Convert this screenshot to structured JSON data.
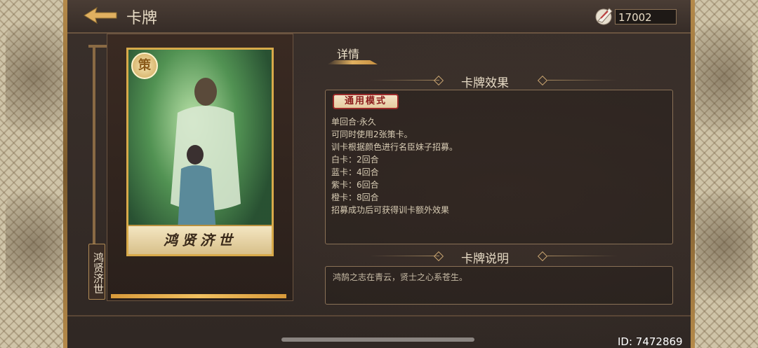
{
  "header": {
    "title": "卡牌",
    "currency_value": "17002"
  },
  "card": {
    "badge": "策",
    "name": "鸿贤济世",
    "vertical_label": "鸿贤济世"
  },
  "tabs": [
    {
      "label": "详情"
    }
  ],
  "sections": {
    "effect_title": "卡牌效果",
    "mode_badge": "通用模式",
    "effect_lines": [
      "单回合·永久",
      "可同时使用2张策卡。",
      "训卡根据颜色进行名臣妹子招募。",
      "白卡：2回合",
      "蓝卡：4回合",
      "紫卡：6回合",
      "橙卡：8回合",
      "招募成功后可获得训卡额外效果"
    ],
    "desc_title": "卡牌说明",
    "desc_text": "鸿鹄之志在青云，贤士之心系苍生。"
  },
  "footer": {
    "id_text": "ID: 7472869"
  },
  "icons": {
    "back": "back-arrow-icon",
    "currency": "feather-currency-icon"
  },
  "colors": {
    "accent_gold": "#d8aa4a",
    "mode_red": "#9a2a2a",
    "text_light": "#e8dcc6"
  }
}
